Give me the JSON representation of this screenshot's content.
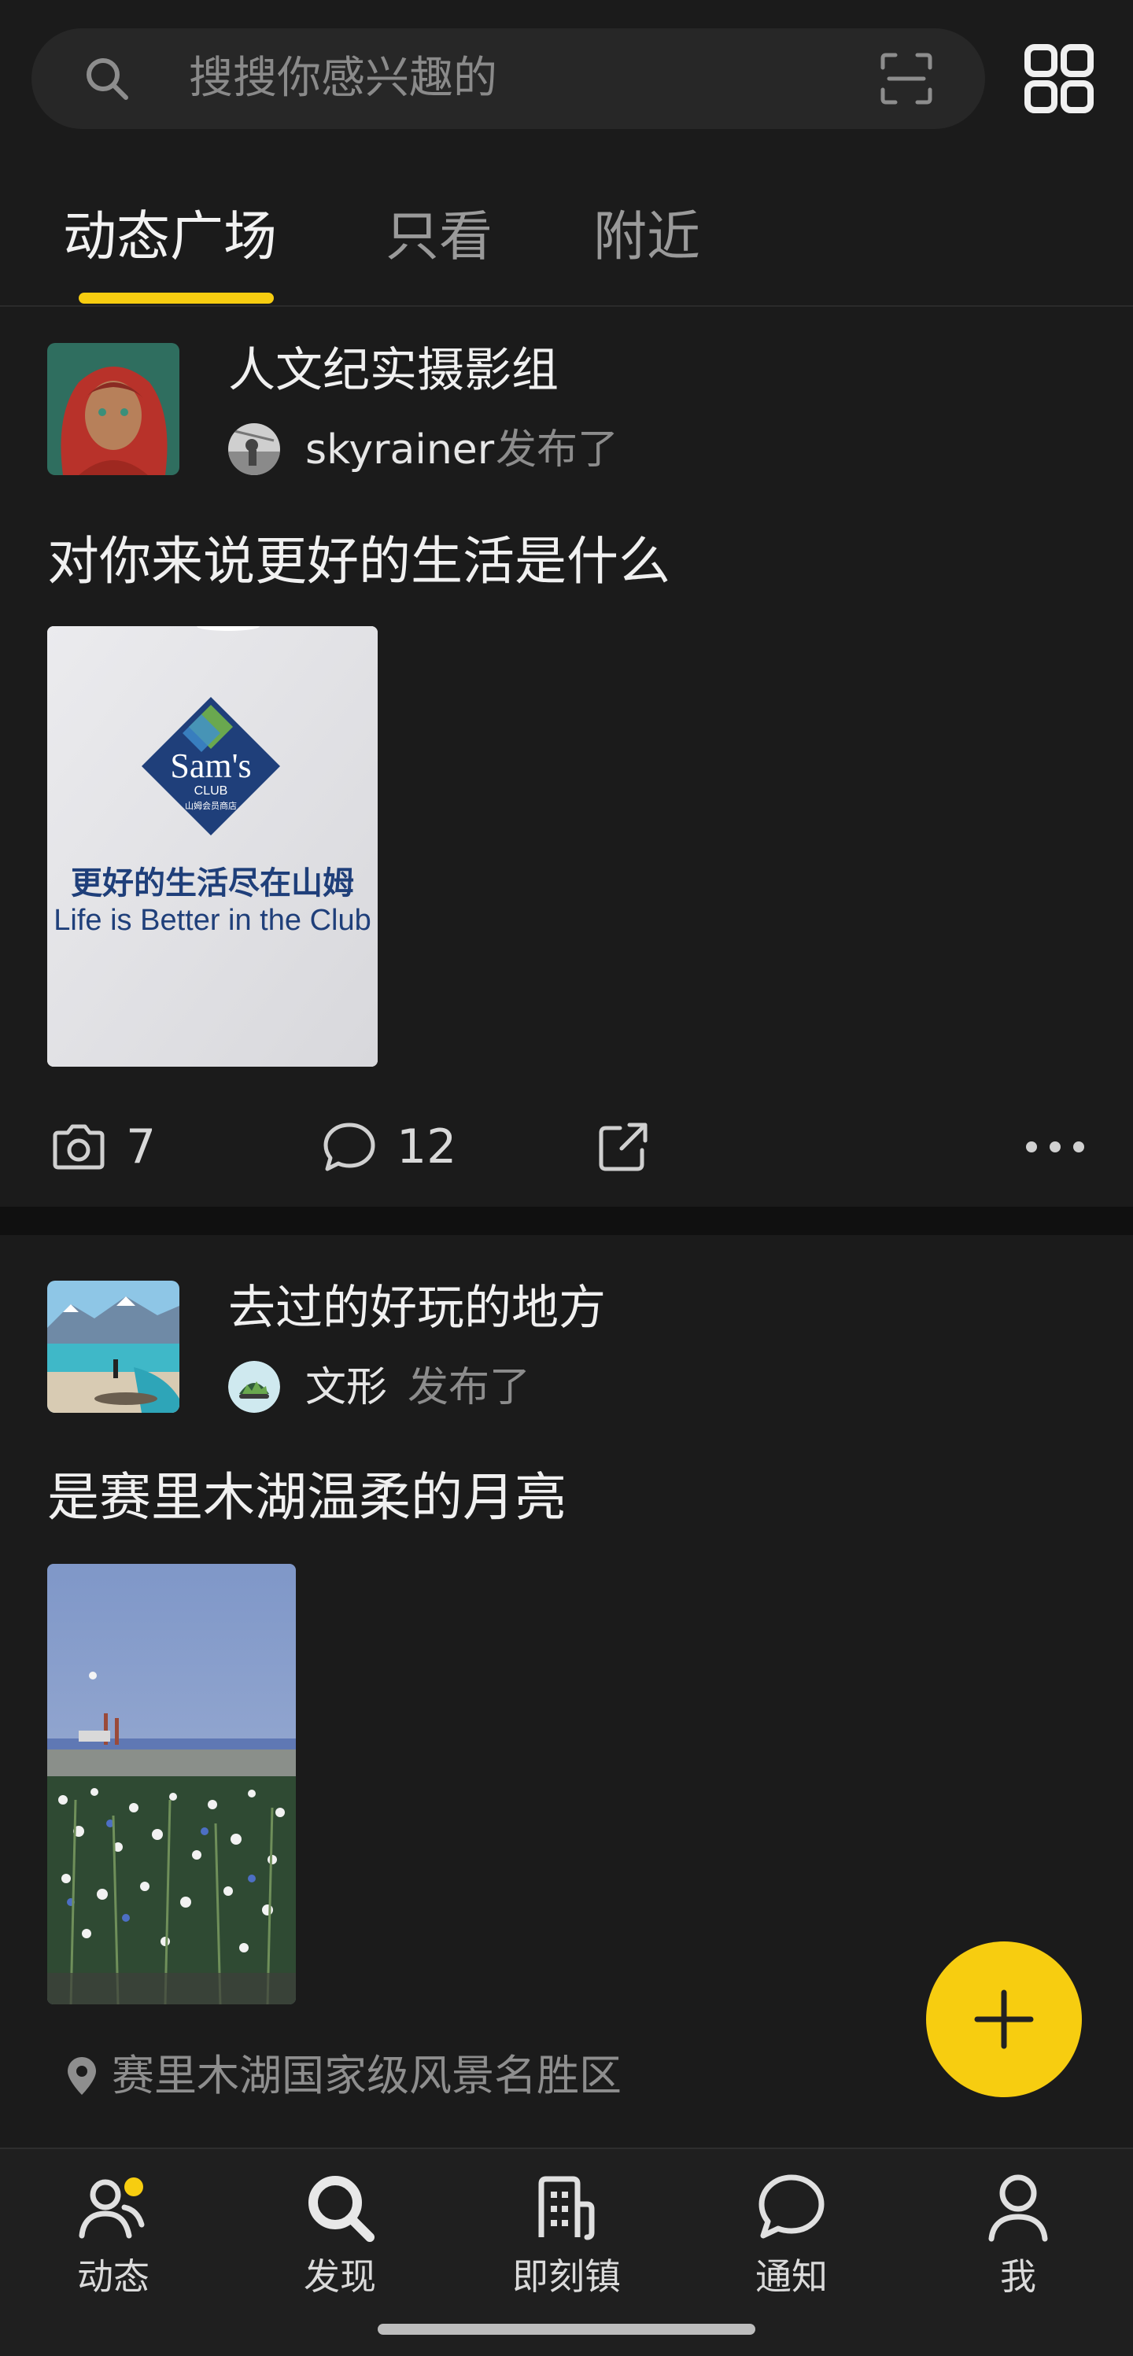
{
  "search": {
    "placeholder": "搜搜你感兴趣的"
  },
  "tabs": [
    {
      "label": "动态广场",
      "active": true
    },
    {
      "label": "只看",
      "active": false
    },
    {
      "label": "附近",
      "active": false
    }
  ],
  "posts": [
    {
      "group": "人文纪实摄影组",
      "author": "skyrainer",
      "action": "发布了",
      "text": "对你来说更好的生活是什么",
      "photo_sign": {
        "logo_line1": "Sam's",
        "logo_line2": "CLUB",
        "logo_line3": "山姆会员商店",
        "zh": "更好的生活尽在山姆",
        "en": "Life is Better in the Club"
      },
      "photos_count": "7",
      "comments_count": "12"
    },
    {
      "group": "去过的好玩的地方",
      "author": "文形",
      "action": "发布了",
      "text": "是赛里木湖温柔的月亮",
      "location": "赛里木湖国家级风景名胜区"
    }
  ],
  "bottom_nav": [
    {
      "label": "动态",
      "icon": "users-icon",
      "badge": true
    },
    {
      "label": "发现",
      "icon": "search-icon"
    },
    {
      "label": "即刻镇",
      "icon": "building-icon"
    },
    {
      "label": "通知",
      "icon": "chat-icon"
    },
    {
      "label": "我",
      "icon": "person-icon"
    }
  ],
  "colors": {
    "accent": "#f7cd10",
    "background": "#1b1b1b"
  }
}
